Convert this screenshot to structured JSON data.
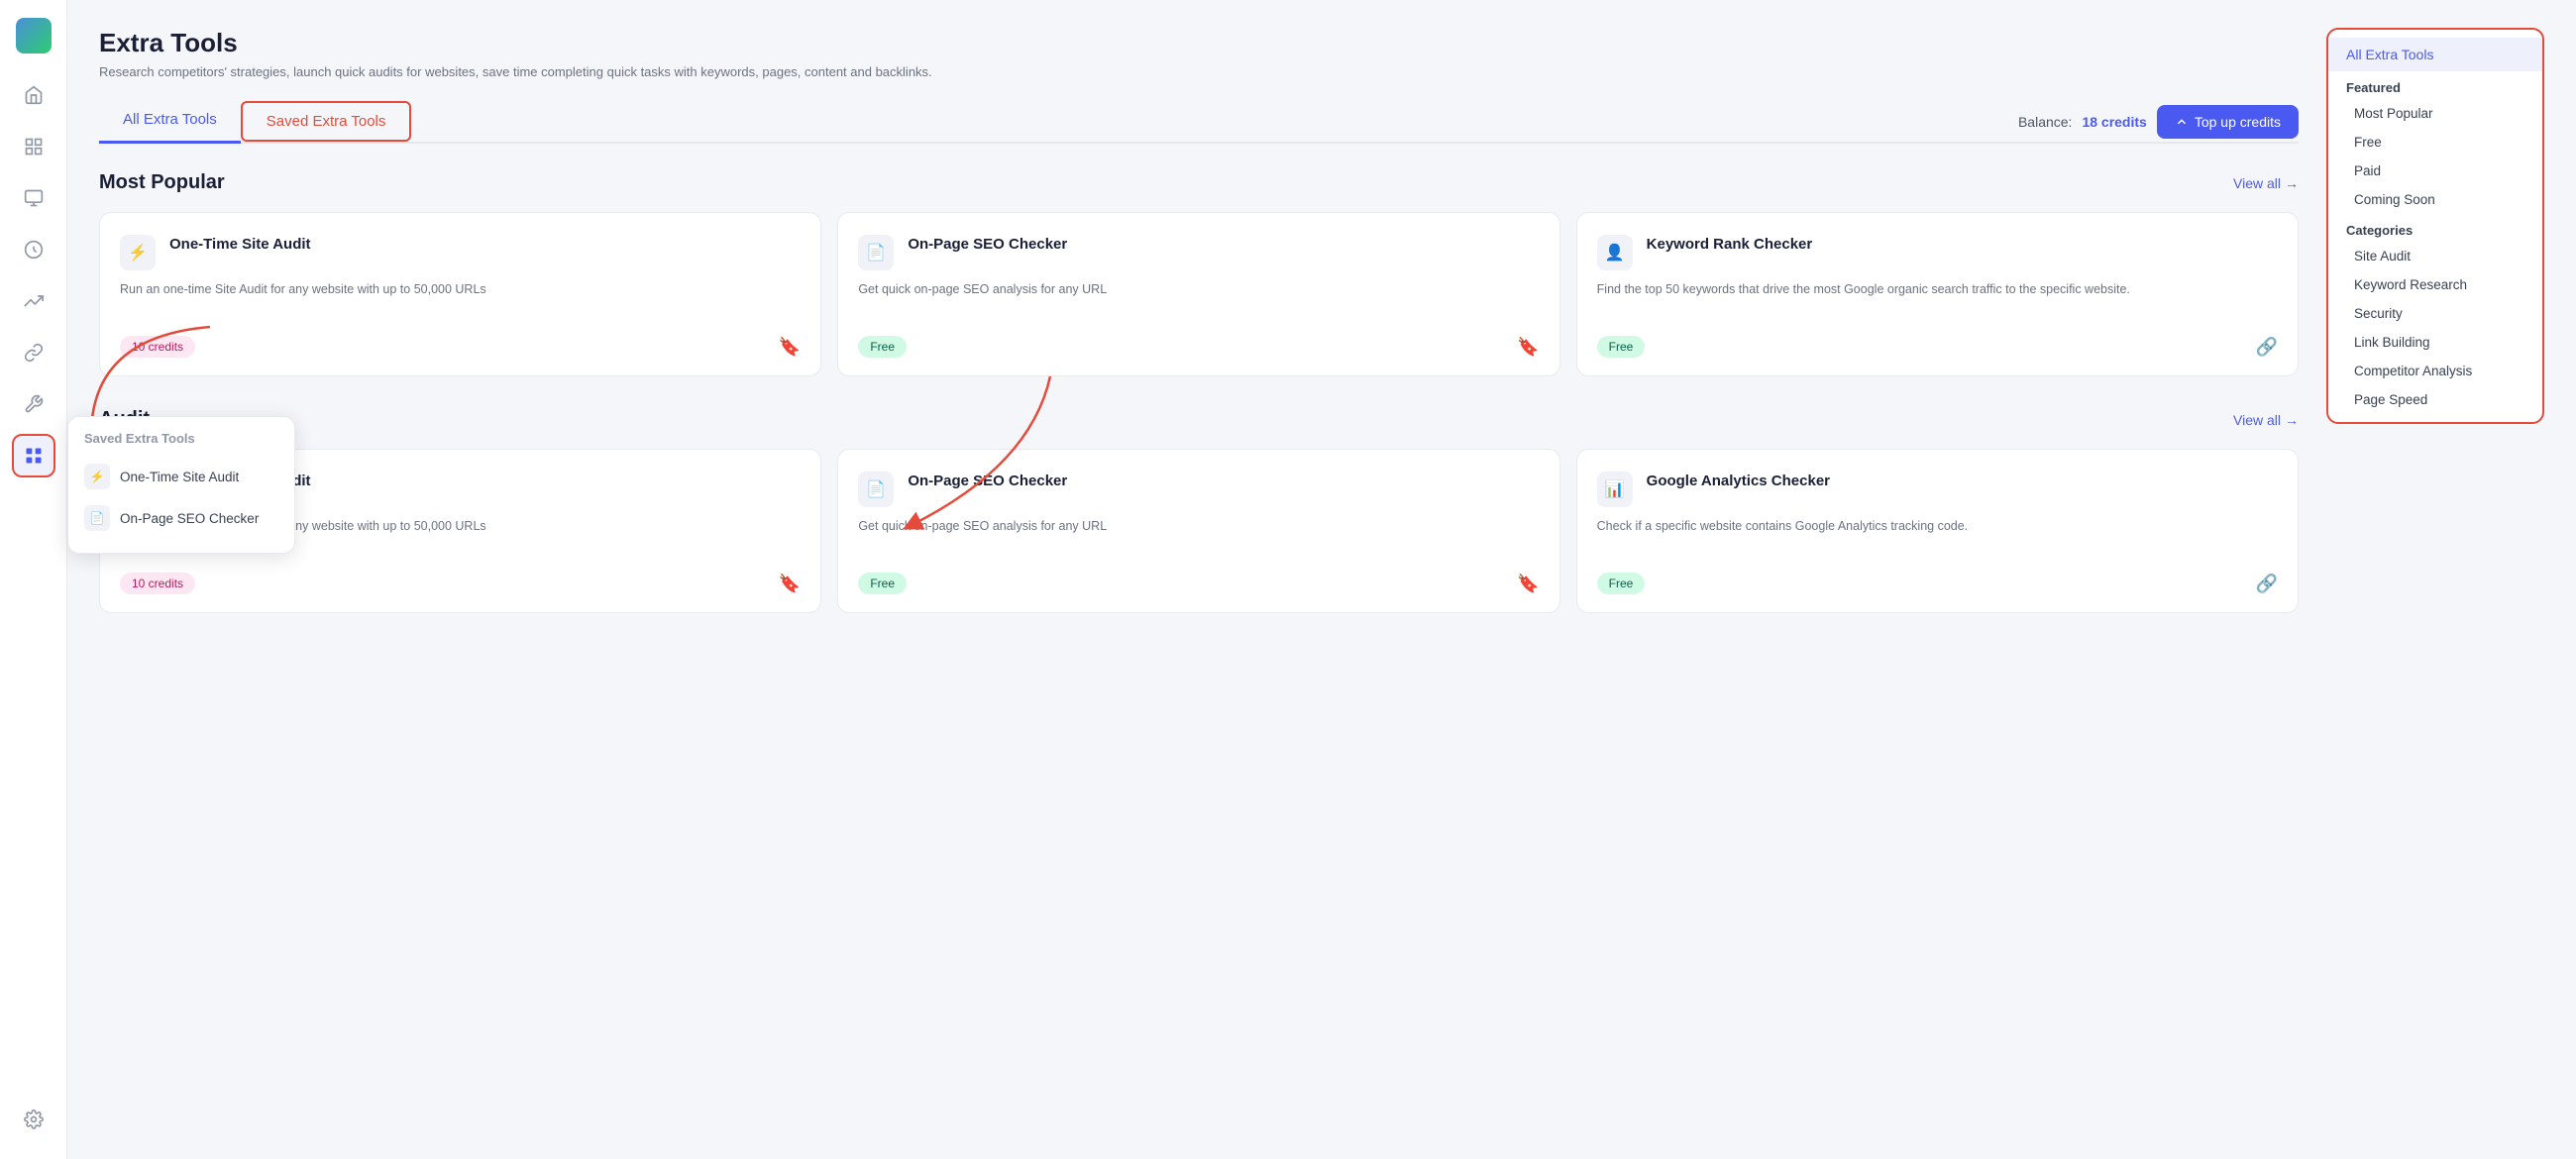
{
  "app": {
    "title": "Extra Tools",
    "subtitle": "Research competitors' strategies, launch quick audits for websites, save time completing quick tasks with keywords, pages, content and backlinks."
  },
  "tabs": {
    "all_label": "All Extra Tools",
    "saved_label": "Saved Extra Tools"
  },
  "balance": {
    "label": "Balance:",
    "credits": "18 credits",
    "topup_label": "Top up credits"
  },
  "sections": [
    {
      "id": "most-popular",
      "title": "Most Popular",
      "view_all": "View all",
      "cards": [
        {
          "title": "One-Time Site Audit",
          "desc": "Run an one-time Site Audit for any website with up to 50,000 URLs",
          "badge": "10 credits",
          "badge_type": "credits",
          "bookmarked": true,
          "icon": "⚡"
        },
        {
          "title": "On-Page SEO Checker",
          "desc": "Get quick on-page SEO analysis for any URL",
          "badge": "Free",
          "badge_type": "free",
          "bookmarked": true,
          "icon": "📄"
        },
        {
          "title": "Keyword Rank Checker",
          "desc": "Find the top 50 keywords that drive the most Google organic search traffic to the specific website.",
          "badge": "Free",
          "badge_type": "free",
          "bookmarked": false,
          "icon": "👤"
        }
      ]
    },
    {
      "id": "site-audit",
      "title": "Audit",
      "view_all": "View all",
      "cards": [
        {
          "title": "One-Time Site Audit",
          "desc": "Run an one-time Site Audit for any website with up to 50,000 URLs",
          "badge": "10 credits",
          "badge_type": "credits",
          "bookmarked": true,
          "icon": "⚡"
        },
        {
          "title": "On-Page SEO Checker",
          "desc": "Get quick on-page SEO analysis for any URL",
          "badge": "Free",
          "badge_type": "free",
          "bookmarked": true,
          "icon": "📄"
        },
        {
          "title": "Google Analytics Checker",
          "desc": "Check if a specific website contains Google Analytics tracking code.",
          "badge": "Free",
          "badge_type": "free",
          "bookmarked": false,
          "icon": "📊"
        }
      ]
    }
  ],
  "right_sidebar": {
    "title": "All Extra Tools",
    "featured_label": "Featured",
    "items": [
      "Most Popular",
      "Free",
      "Paid",
      "Coming Soon"
    ],
    "categories_label": "Categories",
    "categories": [
      "Site Audit",
      "Keyword Research",
      "Security",
      "Link Building",
      "Competitor Analysis",
      "Page Speed"
    ]
  },
  "saved_popup": {
    "title": "Saved Extra Tools",
    "items": [
      {
        "label": "One-Time Site Audit",
        "icon": "⚡"
      },
      {
        "label": "On-Page SEO Checker",
        "icon": "📄"
      }
    ]
  },
  "sidebar_icons": [
    "🏠",
    "🟩",
    "📊",
    "📈",
    "🔗",
    "🔧",
    "🎯",
    "⚙️"
  ],
  "active_sidebar_index": 6
}
